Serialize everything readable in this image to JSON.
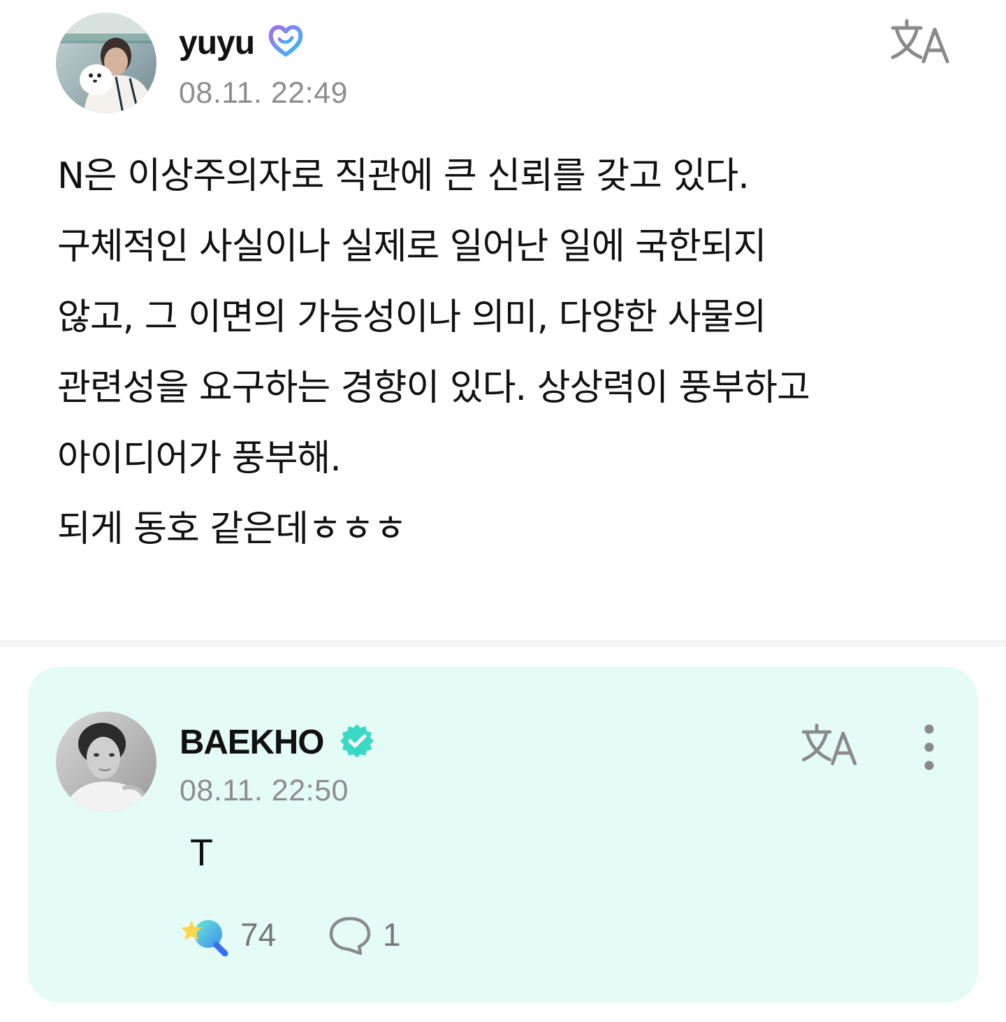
{
  "post": {
    "author": "yuyu",
    "author_badge_icon": "fan-heart-badge-icon",
    "timestamp": "08.11. 22:49",
    "body": "N은 이상주의자로 직관에 큰 신뢰를 갖고 있다.\n구체적인 사실이나 실제로 일어난 일에 국한되지\n않고, 그 이면의 가능성이나 의미, 다양한 사물의\n관련성을 요구하는 경향이 있다. 상상력이 풍부하고\n아이디어가 풍부해.\n되게 동호 같은데ㅎㅎㅎ",
    "translate_icon": "translate-icon"
  },
  "artist_comment": {
    "author": "BAEKHO",
    "author_badge_icon": "verified-check-icon",
    "timestamp": "08.11. 22:50",
    "text": "T",
    "like_count": "74",
    "reply_count": "1",
    "translate_icon": "translate-icon",
    "more_icon": "more-vertical-icon",
    "reaction_icon": "star-reaction-icon",
    "reply_icon": "comment-bubble-icon"
  },
  "colors": {
    "card_background": "#e5fbf5",
    "verified_badge": "#3ad8c5",
    "heart_badge_start": "#a56cf3",
    "heart_badge_end": "#2fc1f0",
    "timestamp": "#8d8d8d",
    "icon_gray": "#8a8a8a"
  }
}
